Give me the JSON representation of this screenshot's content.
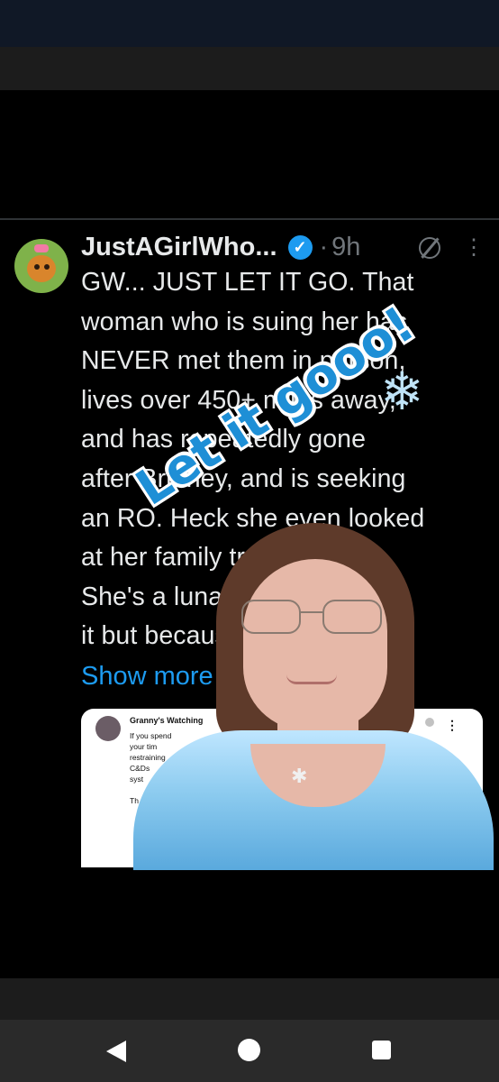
{
  "post": {
    "username": "JustAGirlWho...",
    "separator": "·",
    "time": "9h",
    "body": "GW...  JUST LET IT GO. That\nwoman who is suing her has\nNEVER met them in person,\nlives over 450+ miles away,\nand has repeatedly gone\nafter Brittney, and is seeking\nan RO. Heck she even looked\nat her family tree/ancestry.\nShe's a lunatic. You know\nit but because of issues",
    "show_more": "Show more"
  },
  "quote": {
    "name": "Granny's Watching",
    "text": "If you spend your tim\nrestraining\nC&Ds\nsyst\n\nTh"
  },
  "overlay": {
    "sticker_text": "Let it gooo!",
    "snowflake": "❄"
  },
  "icons": {
    "verified": "verified-badge-icon",
    "grok": "grok-icon",
    "more": "more-options-icon"
  },
  "nav": {
    "back": "back-icon",
    "home": "home-icon",
    "recents": "recents-icon"
  },
  "colors": {
    "accent": "#1d9bf0",
    "background": "#000000",
    "muted": "#71767b"
  }
}
